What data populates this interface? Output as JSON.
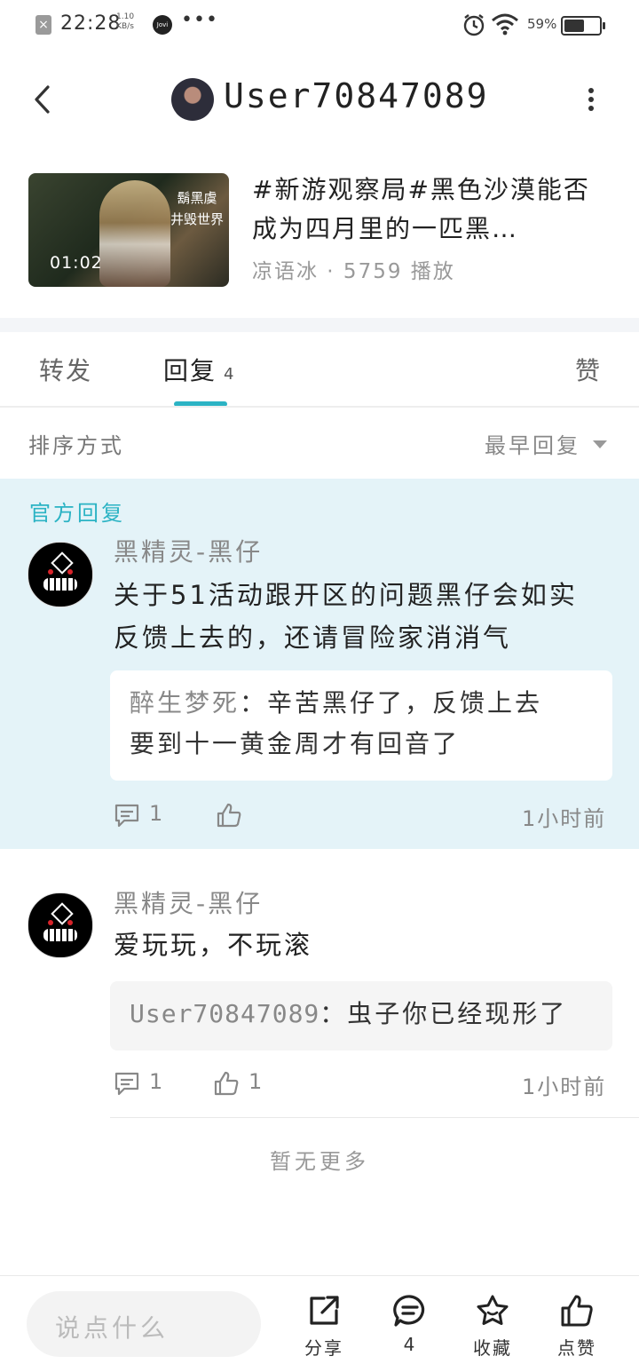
{
  "status_bar": {
    "time": "22:28",
    "speed_value": "1.10",
    "speed_unit": "KB/s",
    "jovi": "Jovi",
    "battery_pct": "59%"
  },
  "header": {
    "username": "User70847089"
  },
  "video": {
    "title": "#新游观察局#黑色沙漠能否成为四月里的一匹黑…",
    "author": "凉语冰",
    "plays": "5759 播放",
    "meta": "凉语冰 · 5759 播放",
    "duration": "01:02",
    "watermark_line1": "鬍黑虞",
    "watermark_line2": "井毁世界"
  },
  "tabs": {
    "forward": "转发",
    "reply": "回复",
    "reply_count": "4",
    "like": "赞"
  },
  "sort": {
    "label": "排序方式",
    "value": "最早回复"
  },
  "official_label": "官方回复",
  "comments": [
    {
      "name": "黑精灵-黑仔",
      "text_line1": "关于51活动跟开区的问题黑仔会如实",
      "text_line2": "反馈上去的，还请冒险家消消气",
      "quote_name": "醉生梦死",
      "quote_text_line1": "：辛苦黑仔了，反馈上去",
      "quote_text_line2": "要到十一黄金周才有回音了",
      "reply_count": "1",
      "like_count": "",
      "time": "1小时前"
    },
    {
      "name": "黑精灵-黑仔",
      "text_line1": "爱玩玩，不玩滚",
      "quote_name": "User70847089",
      "quote_text_line1": "：虫子你已经现形了",
      "reply_count": "1",
      "like_count": "1",
      "time": "1小时前"
    }
  ],
  "no_more": "暂无更多",
  "bottom": {
    "input_placeholder": "说点什么",
    "share": "分享",
    "comment_count": "4",
    "favorite": "收藏",
    "like": "点赞"
  }
}
